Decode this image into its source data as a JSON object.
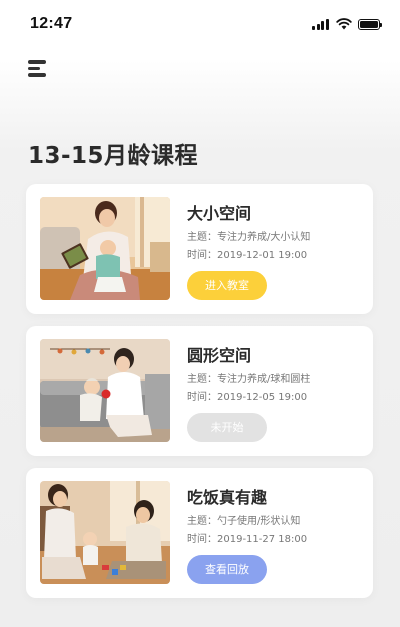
{
  "status_bar": {
    "time": "12:47",
    "icons": [
      "cellular-signal-icon",
      "wifi-icon",
      "battery-icon"
    ]
  },
  "header": {
    "menu_icon": "hamburger-menu-icon",
    "title": "13-15月龄课程"
  },
  "colors": {
    "primary_text": "#2b2b2b",
    "secondary_text": "#777777",
    "button_enter": "#fcd03a",
    "button_disabled": "#e2e2e2",
    "button_replay": "#8aa2ef",
    "card_background": "#ffffff",
    "page_background": "#eeeeee"
  },
  "courses": [
    {
      "title": "大小空间",
      "topic": "主题：专注力养成/大小认知",
      "time": "时间：2019-12-01   19:00",
      "action_label": "进入教室",
      "status": "live",
      "photo": "mother-reading-book-to-baby-photo"
    },
    {
      "title": "圆形空间",
      "topic": "主题：专注力养成/球和圆柱",
      "time": "时间：2019-12-05   19:00",
      "action_label": "未开始",
      "status": "not-started",
      "photo": "mother-playing-ball-with-baby-photo"
    },
    {
      "title": "吃饭真有趣",
      "topic": "主题：勺子使用/形状认知",
      "time": "时间：2019-11-27   18:00",
      "action_label": "查看回放",
      "status": "replay",
      "photo": "family-playing-on-floor-photo"
    }
  ]
}
